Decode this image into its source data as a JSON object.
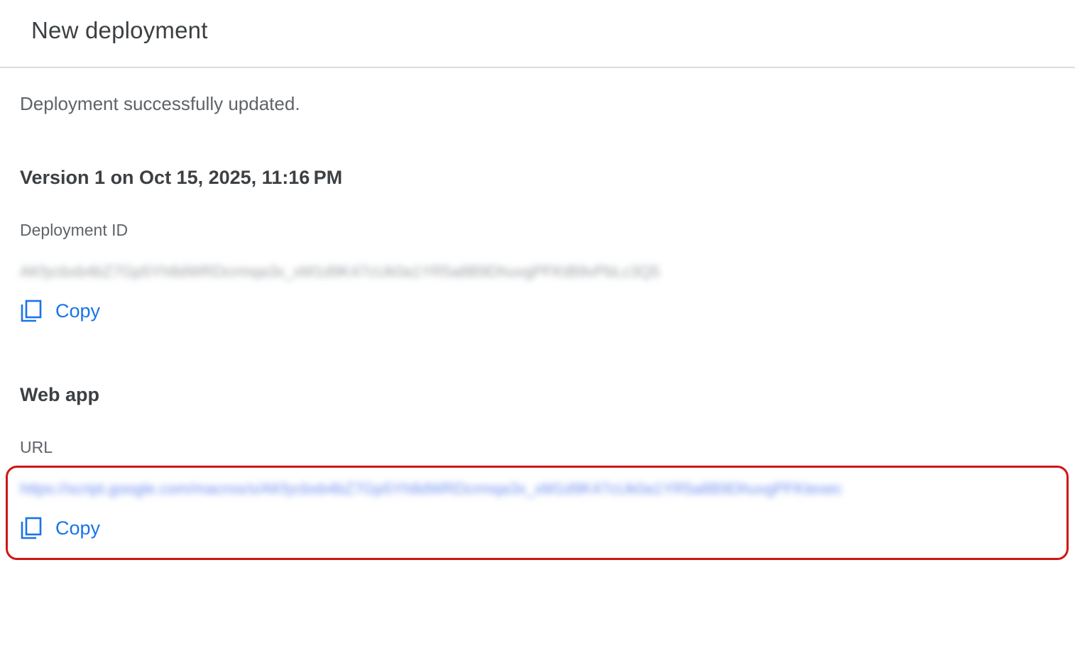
{
  "dialog": {
    "title": "New deployment",
    "status_message": "Deployment successfully updated.",
    "version_heading": "Version 1 on Oct 15, 2025, 11:16 PM"
  },
  "deployment": {
    "label": "Deployment ID",
    "value": "AKfycbxb4bZ7Gp5Yh8dWRDcrmqa3x_xM1d9K47cUk0a1YR5a8B9DhuvgPFKtB9vPbLc3Q5",
    "copy_label": "Copy",
    "copy_icon": "content-copy-icon"
  },
  "web_app": {
    "heading": "Web app",
    "url_label": "URL",
    "url_value": "https://script.google.com/macros/s/AKfycbxb4bZ7Gp5Yh8dWRDcrmqa3x_xM1d9K47cUk0a1YR5a8B9DhuvgPFKtexec",
    "copy_label": "Copy",
    "copy_icon": "content-copy-icon"
  },
  "colors": {
    "accent": "#1a73e8",
    "highlight": "#d01515",
    "divider": "#dadce0"
  }
}
